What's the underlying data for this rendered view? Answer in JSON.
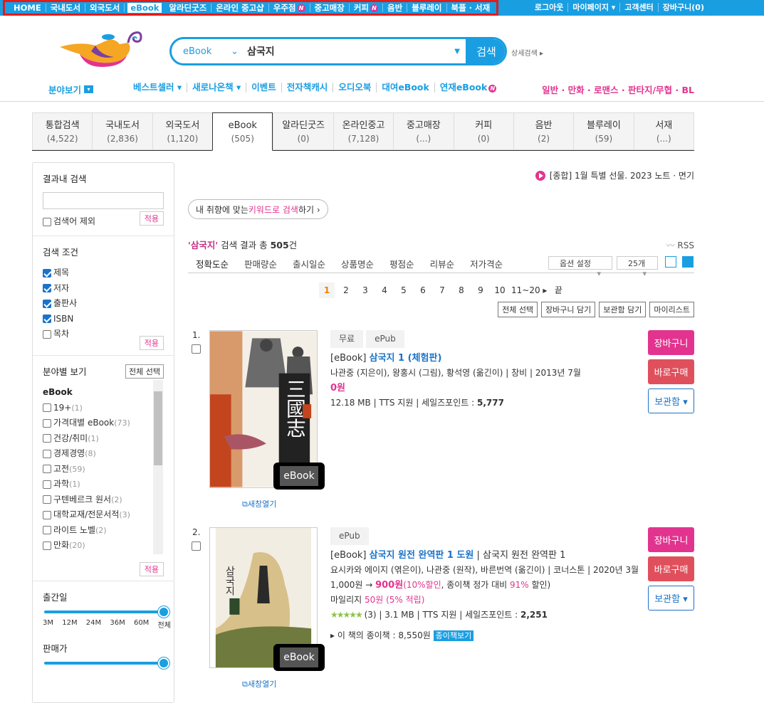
{
  "topnav": {
    "items": [
      "HOME",
      "국내도서",
      "외국도서",
      "eBook",
      "알라딘굿즈",
      "온라인 중고샵",
      "우주점",
      "중고매장",
      "커피",
      "음반",
      "블루레이",
      "북플 · 서재"
    ],
    "badge": "N",
    "right": [
      "로그아웃",
      "마이페이지 ▾",
      "고객센터",
      "장바구니(0)"
    ]
  },
  "search": {
    "category": "eBook",
    "query": "삼국지",
    "button": "검색",
    "detail": "상세검색 ▸"
  },
  "catnav": {
    "label": "분야보기",
    "items": [
      "베스트셀러 ▾",
      "새로나온책 ▾",
      "이벤트",
      "전자책캐시",
      "오디오북",
      "대여eBook",
      "연재eBook"
    ],
    "genres": "일반 · 만화 · 로맨스 · 판타지/무협 · BL"
  },
  "tabs": [
    {
      "label": "통합검색",
      "count": "(4,522)"
    },
    {
      "label": "국내도서",
      "count": "(2,836)"
    },
    {
      "label": "외국도서",
      "count": "(1,120)"
    },
    {
      "label": "eBook",
      "count": "(505)"
    },
    {
      "label": "알라딘굿즈",
      "count": "(0)"
    },
    {
      "label": "온라인중고",
      "count": "(7,128)"
    },
    {
      "label": "중고매장",
      "count": "(...)"
    },
    {
      "label": "커피",
      "count": "(0)"
    },
    {
      "label": "음반",
      "count": "(2)"
    },
    {
      "label": "블루레이",
      "count": "(59)"
    },
    {
      "label": "서재",
      "count": "(...)"
    }
  ],
  "sidebar": {
    "inner_search": "결과내 검색",
    "exclude": "검색어 제외",
    "apply": "적용",
    "cond_title": "검색 조건",
    "conditions": [
      {
        "label": "제목",
        "checked": true
      },
      {
        "label": "저자",
        "checked": true
      },
      {
        "label": "출판사",
        "checked": true
      },
      {
        "label": "ISBN",
        "checked": true
      },
      {
        "label": "목차",
        "checked": false
      }
    ],
    "field_title": "분야별 보기",
    "select_all": "전체 선택",
    "field_head": "eBook",
    "fields": [
      {
        "label": "19+",
        "count": "(1)"
      },
      {
        "label": "가격대별 eBook",
        "count": "(73)"
      },
      {
        "label": "건강/취미",
        "count": "(1)"
      },
      {
        "label": "경제경영",
        "count": "(8)"
      },
      {
        "label": "고전",
        "count": "(59)"
      },
      {
        "label": "과학",
        "count": "(1)"
      },
      {
        "label": "구텐베르크 원서",
        "count": "(2)"
      },
      {
        "label": "대학교재/전문서적",
        "count": "(3)"
      },
      {
        "label": "라이트 노벨",
        "count": "(2)"
      },
      {
        "label": "만화",
        "count": "(20)"
      }
    ],
    "date_title": "출간일",
    "date_ticks": [
      "3M",
      "12M",
      "24M",
      "36M",
      "60M",
      "전체"
    ],
    "price_title": "판매가"
  },
  "banner": "[종합] 1월 특별 선물. 2023 노트 · 면기",
  "keyword_btn": {
    "pre": "내 취향에 맞는 ",
    "kw": "키워드로 검색",
    "post": "하기 ›"
  },
  "result": {
    "query": "'삼국지'",
    "text": " 검색 결과 총 ",
    "count": "505",
    "unit": "건",
    "rss": "RSS"
  },
  "sort": [
    "정확도순",
    "판매량순",
    "출시일순",
    "상품명순",
    "평점순",
    "리뷰순",
    "저가격순"
  ],
  "options": {
    "opt": "옵션 설정",
    "per": "25개"
  },
  "pager": [
    "1",
    "2",
    "3",
    "4",
    "5",
    "6",
    "7",
    "8",
    "9",
    "10",
    "11~20 ▸",
    "끝"
  ],
  "actions": [
    "전체 선택",
    "장바구니 담기",
    "보관함 담기",
    "마이리스트"
  ],
  "items": [
    {
      "num": "1.",
      "tags": [
        "무료",
        "ePub"
      ],
      "prefix": "[eBook] ",
      "title": "삼국지 1 (체험판)",
      "series": "",
      "authors": "나관중 (지은이), 왕홍시 (그림), 황석영 (옮긴이) | 창비 | 2013년 7월",
      "price": "0원",
      "meta1": "12.18 MB | TTS 지원 | 세일즈포인트 : ",
      "sales": "5,777",
      "badge": "eBook",
      "newwin": "새창열기",
      "cover_title": "三國志"
    },
    {
      "num": "2.",
      "tags": [
        "ePub"
      ],
      "prefix": "[eBook] ",
      "title": "삼국지 원전 완역판 1 도원",
      "series": " | 삼국지 원전 완역판 1",
      "authors": "요시카와 에이지 (엮은이), 나관중 (원작), 바른번역 (옮긴이) | 코너스톤 | 2020년 3월",
      "price_line": {
        "orig": "1,000원 → ",
        "sale": "900원",
        "rate": "(10%할인",
        "rest": ", 종이책 정가 대비 ",
        "pct": "91%",
        "end": " 할인)"
      },
      "mileage": {
        "pre": "마일리지 ",
        "val": "50원",
        "rate": " (5% 적립)"
      },
      "meta1": " (3) | 3.1 MB | TTS 지원 | 세일즈포인트 : ",
      "sales": "2,251",
      "paper": "▸ 이 책의 종이책 : 8,550원 ",
      "paper_btn": "종이책보기",
      "badge": "eBook",
      "newwin": "새창열기",
      "cover_title": "삼국지"
    }
  ],
  "buttons": {
    "cart": "장바구니",
    "buy": "바로구매",
    "save": "보관함 ▾"
  }
}
